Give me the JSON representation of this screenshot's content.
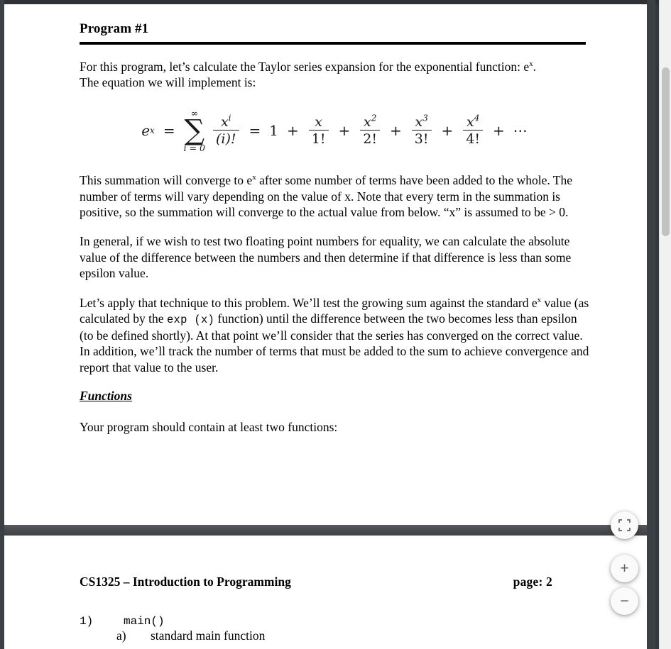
{
  "viewer": {
    "scrollbar": {
      "name": "vertical-scrollbar"
    },
    "controls": {
      "fit_label": "Fit to page",
      "zoom_in_label": "+",
      "zoom_out_label": "−"
    }
  },
  "document": {
    "page1": {
      "heading": "Program #1",
      "paragraphs": {
        "intro_part1": "For this program, let’s calculate the Taylor series expansion for the exponential function:  e",
        "intro_sup": "x",
        "intro_part2": ".",
        "intro_line2": "The equation we will implement is:",
        "converge_part1": "This summation will converge to e",
        "converge_sup": "x",
        "converge_part2": " after some number of terms have been added to the whole. The number of terms will vary depending on the value of x.  Note that every term in the summation is positive, so the summation will converge to the actual value from below.  “x” is assumed to be > 0.",
        "epsilon": "In general, if we wish to test two floating point numbers for equality, we can calculate the absolute value of the difference between the numbers and then determine if that difference is less than some epsilon value.",
        "technique_part1": "Let’s apply that technique to this problem.  We’ll test the growing sum against the standard e",
        "technique_sup": "x",
        "technique_part2": " value (as calculated by the ",
        "technique_code": "exp (x)",
        "technique_part3": " function) until the difference between the two becomes less than epsilon (to be defined shortly).  At that point we’ll consider that the series has converged on the correct value.  In addition, we’ll track the number of terms that must be added to the sum to achieve convergence and report that value to the user."
      },
      "subheading": "Functions",
      "functions_intro": "Your program should contain at least two functions:"
    },
    "equation": {
      "lhs_base": "e",
      "lhs_exp": "x",
      "equals_1": "=",
      "sigma_top": "∞",
      "sigma_symbol": "∑",
      "sigma_bottom": "i = 0",
      "sum_numerator": "x",
      "sum_numerator_exp": "i",
      "sum_denominator": "(i)!",
      "equals_2": "=",
      "first_term": "1",
      "plus_1": "+",
      "t1_num": "x",
      "t1_den": "1!",
      "plus_2": "+",
      "t2_num": "x",
      "t2_num_exp": "2",
      "t2_den": "2!",
      "plus_3": "+",
      "t3_num": "x",
      "t3_num_exp": "3",
      "t3_den": "3!",
      "plus_4": "+",
      "t4_num": "x",
      "t4_num_exp": "4",
      "t4_den": "4!",
      "plus_5": "+",
      "ellipsis": "⋯"
    },
    "page2": {
      "header_left": "CS1325 – Introduction to Programming",
      "header_right": "page:  2",
      "list": [
        {
          "marker": "1)",
          "text": "main()",
          "style": "mono"
        },
        {
          "marker": "a)",
          "text": "standard main function",
          "style": "serif"
        }
      ]
    }
  }
}
